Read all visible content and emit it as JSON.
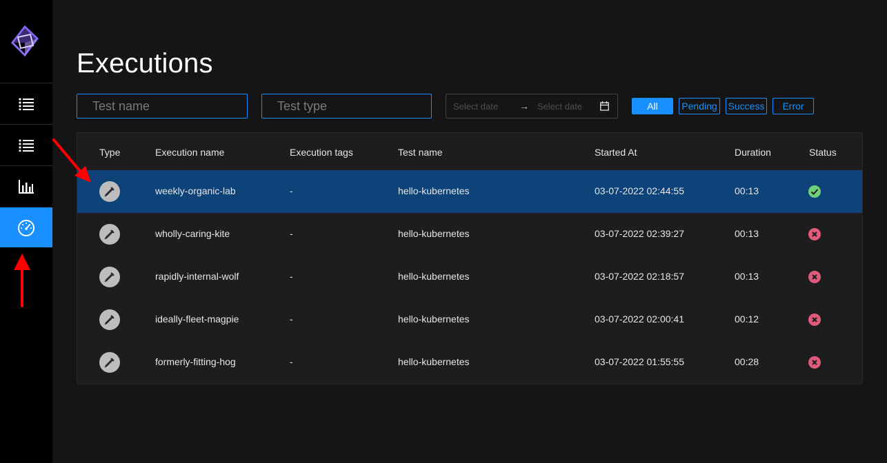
{
  "sidebar": {
    "items": [
      {
        "icon": "list-icon",
        "active": false
      },
      {
        "icon": "list-icon",
        "active": false
      },
      {
        "icon": "bar-chart-icon",
        "active": false
      },
      {
        "icon": "dashboard-gauge-icon",
        "active": true
      }
    ]
  },
  "page": {
    "title": "Executions"
  },
  "filters": {
    "test_name_placeholder": "Test name",
    "test_type_placeholder": "Test type",
    "date_start_placeholder": "Select date",
    "date_end_placeholder": "Select date",
    "date_separator": "→",
    "status_buttons": {
      "all": "All",
      "pending": "Pending",
      "success": "Success",
      "error": "Error"
    },
    "active_status": "All"
  },
  "table": {
    "columns": {
      "type": "Type",
      "name": "Execution name",
      "tags": "Execution tags",
      "test": "Test name",
      "started": "Started At",
      "duration": "Duration",
      "status": "Status"
    },
    "rows": [
      {
        "type_icon": "postman-icon",
        "name": "weekly-organic-lab",
        "tags": "-",
        "test": "hello-kubernetes",
        "started": "03-07-2022 02:44:55",
        "duration": "00:13",
        "status": "success"
      },
      {
        "type_icon": "postman-icon",
        "name": "wholly-caring-kite",
        "tags": "-",
        "test": "hello-kubernetes",
        "started": "03-07-2022 02:39:27",
        "duration": "00:13",
        "status": "error"
      },
      {
        "type_icon": "postman-icon",
        "name": "rapidly-internal-wolf",
        "tags": "-",
        "test": "hello-kubernetes",
        "started": "03-07-2022 02:18:57",
        "duration": "00:13",
        "status": "error"
      },
      {
        "type_icon": "postman-icon",
        "name": "ideally-fleet-magpie",
        "tags": "-",
        "test": "hello-kubernetes",
        "started": "03-07-2022 02:00:41",
        "duration": "00:12",
        "status": "error"
      },
      {
        "type_icon": "postman-icon",
        "name": "formerly-fitting-hog",
        "tags": "-",
        "test": "hello-kubernetes",
        "started": "03-07-2022 01:55:55",
        "duration": "00:28",
        "status": "error"
      }
    ],
    "selected_row": 0
  },
  "colors": {
    "accent": "#1890ff",
    "selected_row": "#0d4379",
    "success": "#6fcf7a",
    "error": "#e05a7c",
    "annotation": "#ff0000"
  }
}
